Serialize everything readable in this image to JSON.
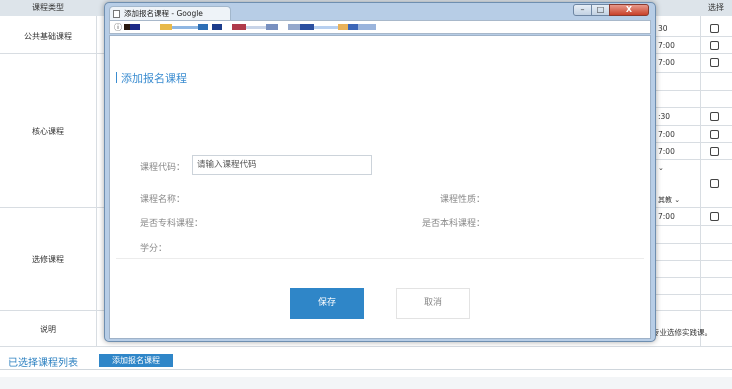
{
  "table": {
    "headers": {
      "course_type": "课程类型",
      "select": "选择"
    },
    "rows": [
      {
        "label": "公共基础课程"
      },
      {
        "label": "核心课程"
      },
      {
        "label": "选修课程"
      },
      {
        "label": "说明"
      }
    ],
    "times": [
      "30",
      "7:00",
      "7:00",
      ":30",
      "7:00",
      "7:00",
      "7:00"
    ],
    "mini_select": "其教",
    "note": "专业选修实践课。"
  },
  "footer": {
    "selected_list_title": "已选择课程列表",
    "add_button": "添加报名课程"
  },
  "window": {
    "tab_title": "添加报名课程 - Google Chrome",
    "close_glyph": "X",
    "min_glyph": "–",
    "max_glyph": "□"
  },
  "dialog": {
    "title": "添加报名课程",
    "fields": {
      "course_code_label": "课程代码：",
      "course_code_placeholder": "请输入课程代码",
      "course_name_label": "课程名称：",
      "course_nature_label": "课程性质：",
      "is_specialty_label": "是否专科课程：",
      "is_undergrad_label": "是否本科课程：",
      "credit_label": "学分："
    },
    "save_button": "保存",
    "cancel_button": "取消"
  },
  "colors": {
    "accent": "#2f86c8",
    "title_blue": "#3a8cd0"
  }
}
